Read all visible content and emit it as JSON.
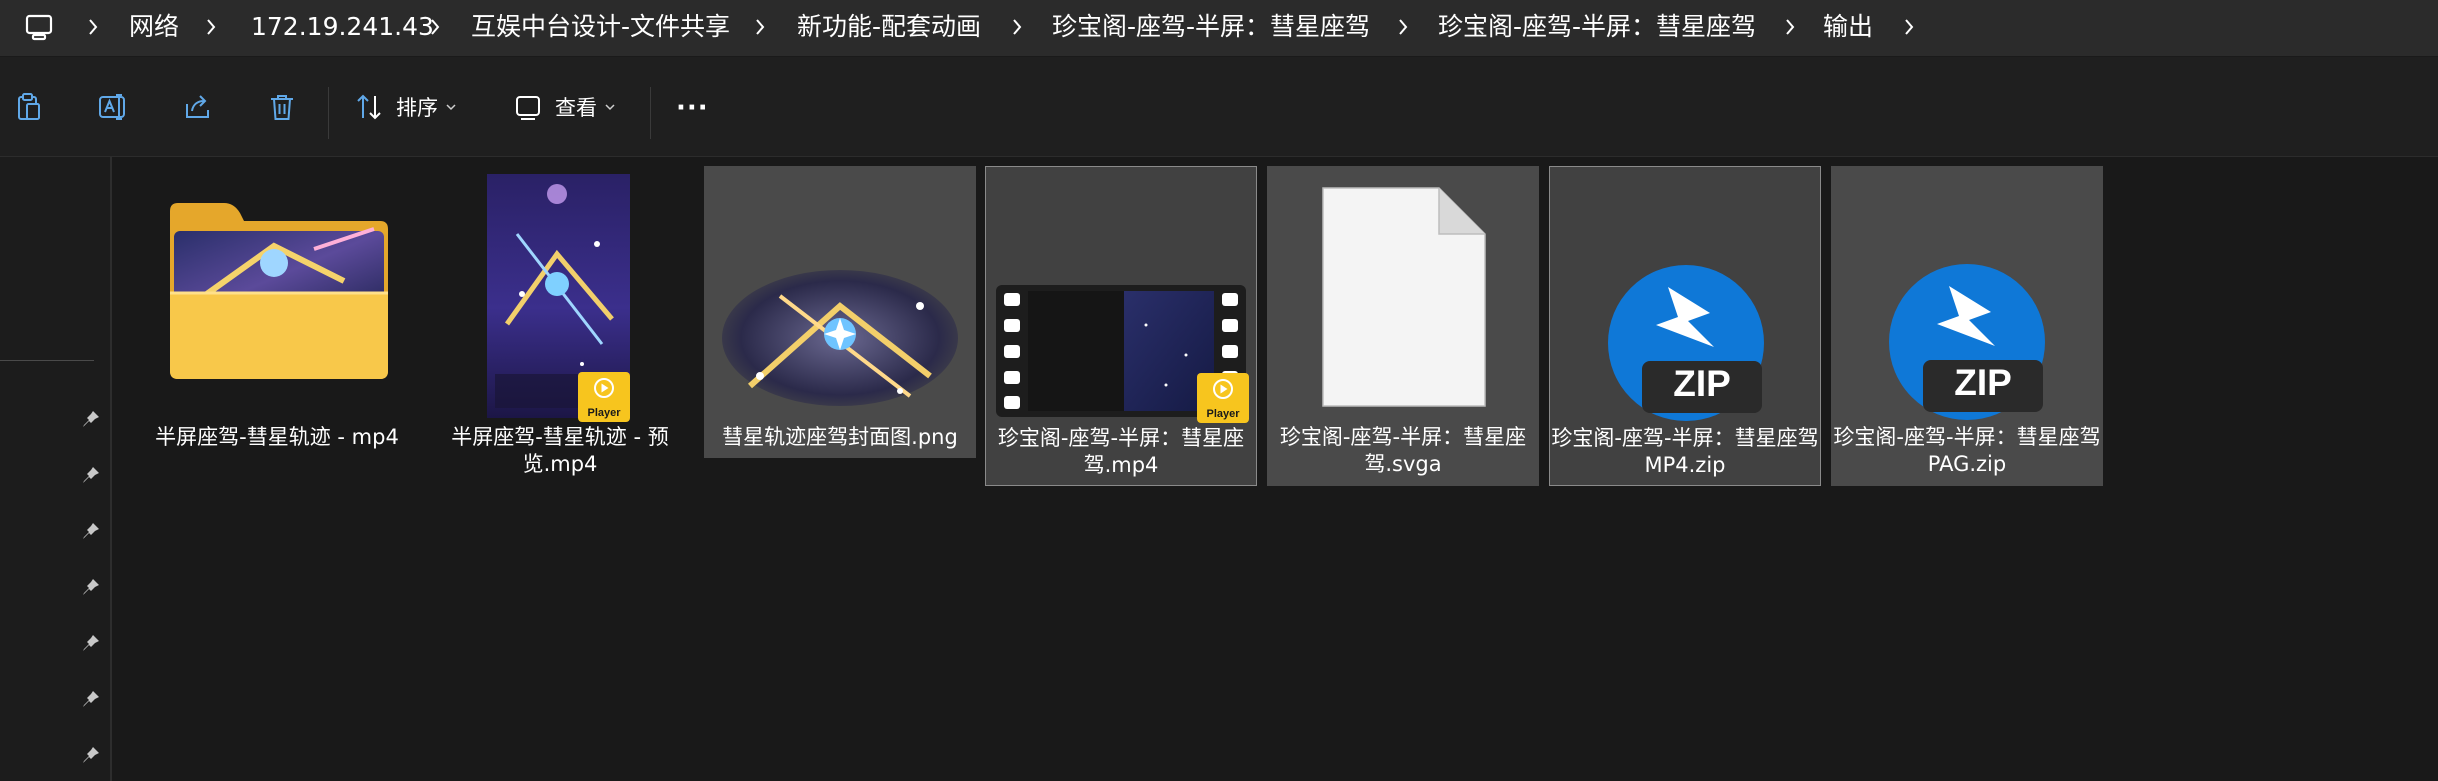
{
  "address_bar": {
    "crumbs": [
      "网络",
      "172.19.241.43",
      "互娱中台设计-文件共享",
      "新功能-配套动画",
      "珍宝阁-座驾-半屏：彗星座驾",
      "珍宝阁-座驾-半屏：彗星座驾",
      "输出"
    ]
  },
  "toolbar": {
    "sort_label": "排序",
    "view_label": "查看",
    "more_label": "···"
  },
  "files": [
    {
      "name": "半屏座驾-彗星轨迹 - mp4",
      "kind": "folder-icon"
    },
    {
      "name": "半屏座驾-彗星轨迹 - 预览.mp4",
      "kind": "video-thumb",
      "badge": "Player"
    },
    {
      "name": "彗星轨迹座驾封面图.png",
      "kind": "image-thumb"
    },
    {
      "name": "珍宝阁-座驾-半屏：彗星座驾.mp4",
      "kind": "film-thumb",
      "badge": "Player"
    },
    {
      "name": "珍宝阁-座驾-半屏：彗星座驾.svga",
      "kind": "blank-file-icon"
    },
    {
      "name": "珍宝阁-座驾-半屏：彗星座驾MP4.zip",
      "kind": "zip-icon",
      "badge": "ZIP"
    },
    {
      "name": "珍宝阁-座驾-半屏：彗星座驾PAG.zip",
      "kind": "zip-icon",
      "badge": "ZIP"
    }
  ],
  "colors": {
    "background": "#191919",
    "selected": "#4a4a4a",
    "folder": "#f6c445",
    "zip_blue": "#0f78d7",
    "player_badge": "#f7c51e"
  }
}
